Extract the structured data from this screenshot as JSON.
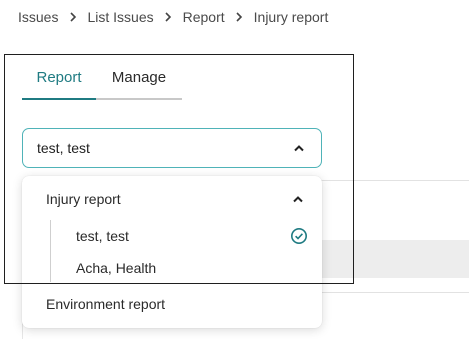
{
  "breadcrumb": {
    "items": [
      "Issues",
      "List Issues",
      "Report"
    ],
    "current": "Injury report"
  },
  "tabs": {
    "report": "Report",
    "manage": "Manage",
    "active": "Report"
  },
  "select": {
    "value": "test, test"
  },
  "dropdown": {
    "groups": [
      {
        "label": "Injury report",
        "expanded": true,
        "options": [
          {
            "label": "test, test",
            "selected": true
          },
          {
            "label": "Acha, Health",
            "selected": false
          }
        ]
      },
      {
        "label": "Environment report",
        "expanded": false
      }
    ]
  },
  "colors": {
    "accent": "#1f7b82",
    "select_border": "#4fb3b8",
    "panel_border": "#1f1f1f"
  }
}
